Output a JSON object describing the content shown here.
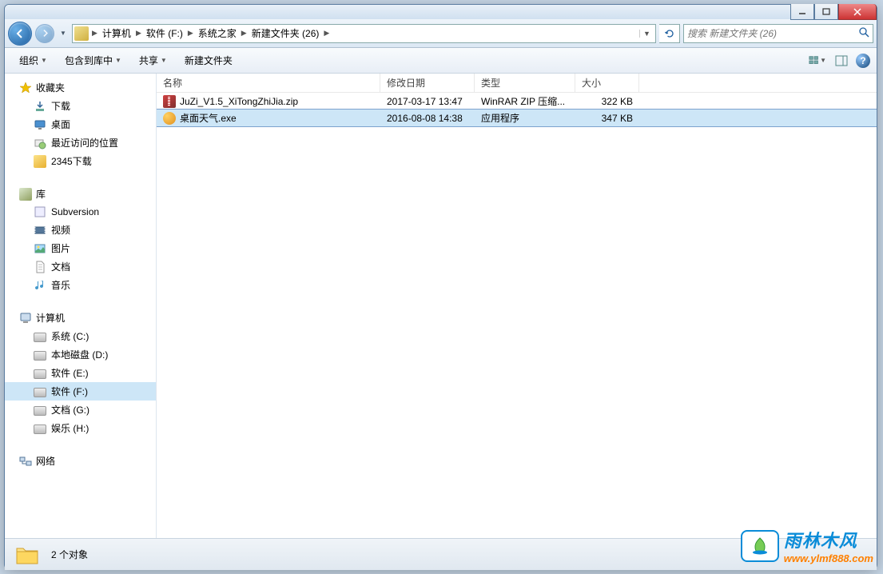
{
  "breadcrumbs": [
    "计算机",
    "软件 (F:)",
    "系统之家",
    "新建文件夹 (26)"
  ],
  "search": {
    "placeholder": "搜索 新建文件夹 (26)"
  },
  "toolbar": {
    "organize": "组织",
    "include": "包含到库中",
    "share": "共享",
    "newfolder": "新建文件夹"
  },
  "columns": {
    "name": "名称",
    "modified": "修改日期",
    "type": "类型",
    "size": "大小"
  },
  "sidebar": {
    "favorites": {
      "label": "收藏夹",
      "items": [
        "下载",
        "桌面",
        "最近访问的位置",
        "2345下载"
      ]
    },
    "libraries": {
      "label": "库",
      "items": [
        "Subversion",
        "视频",
        "图片",
        "文档",
        "音乐"
      ]
    },
    "computer": {
      "label": "计算机",
      "items": [
        "系统 (C:)",
        "本地磁盘 (D:)",
        "软件 (E:)",
        "软件 (F:)",
        "文档 (G:)",
        "娱乐 (H:)"
      ],
      "selected": 3
    },
    "network": {
      "label": "网络"
    }
  },
  "files": [
    {
      "name": "JuZi_V1.5_XiTongZhiJia.zip",
      "modified": "2017-03-17 13:47",
      "type": "WinRAR ZIP 压缩...",
      "size": "322 KB",
      "icon": "zip"
    },
    {
      "name": "桌面天气.exe",
      "modified": "2016-08-08 14:38",
      "type": "应用程序",
      "size": "347 KB",
      "icon": "exe",
      "selected": true
    }
  ],
  "status": {
    "count": "2 个对象"
  },
  "watermark": {
    "cn": "雨林木风",
    "url": "www.ylmf888.com"
  }
}
